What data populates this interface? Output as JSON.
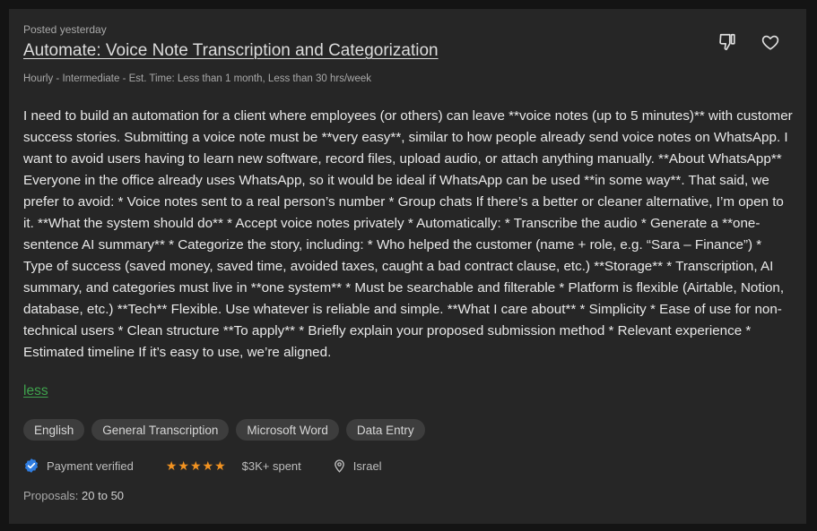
{
  "job": {
    "posted": "Posted yesterday",
    "title": "Automate: Voice Note Transcription and Categorization",
    "meta": "Hourly - Intermediate - Est. Time: Less than 1 month, Less than 30 hrs/week",
    "description": "I need to build an automation for a client where employees (or others) can leave **voice notes (up to 5 minutes)** with customer success stories. Submitting a voice note must be **very easy**, similar to how people already send voice notes on WhatsApp. I want to avoid users having to learn new software, record files, upload audio, or attach anything manually. **About WhatsApp** Everyone in the office already uses WhatsApp, so it would be ideal if WhatsApp can be used **in some way**. That said, we prefer to avoid: * Voice notes sent to a real person’s number * Group chats If there’s a better or cleaner alternative, I’m open to it. **What the system should do** * Accept voice notes privately * Automatically: * Transcribe the audio * Generate a **one-sentence AI summary** * Categorize the story, including: * Who helped the customer (name + role, e.g. “Sara – Finance”) * Type of success (saved money, saved time, avoided taxes, caught a bad contract clause, etc.) **Storage** * Transcription, AI summary, and categories must live in **one system** * Must be searchable and filterable * Platform is flexible (Airtable, Notion, database, etc.) **Tech** Flexible. Use whatever is reliable and simple. **What I care about** * Simplicity * Ease of use for non-technical users * Clean structure **To apply** * Briefly explain your proposed submission method * Relevant experience * Estimated timeline If it’s easy to use, we’re aligned.",
    "less_label": "less",
    "tags": [
      "English",
      "General Transcription",
      "Microsoft Word",
      "Data Entry"
    ],
    "payment_verified": "Payment verified",
    "rating_stars": 5,
    "spent": "$3K+ spent",
    "location": "Israel",
    "proposals_label": "Proposals:",
    "proposals_value": "20 to 50"
  },
  "icons": {
    "dislike": "thumbs-down-icon",
    "save": "heart-icon",
    "verified": "verified-badge-icon",
    "star": "star-icon",
    "location": "location-pin-icon"
  },
  "colors": {
    "background": "#141414",
    "card": "#262626",
    "accent_green": "#3fa34d",
    "star": "#f29321",
    "verified_blue": "#2f7de1",
    "tag_bg": "#3d3d3d"
  }
}
